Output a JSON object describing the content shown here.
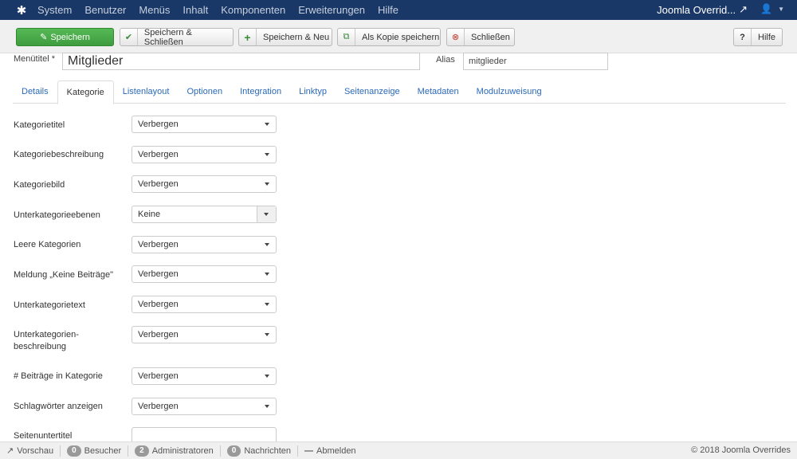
{
  "navbar": {
    "logo_icon": "joomla-icon",
    "menu": [
      "System",
      "Benutzer",
      "Menüs",
      "Inhalt",
      "Komponenten",
      "Erweiterungen",
      "Hilfe"
    ],
    "site_name": "Joomla Overrid...",
    "bg_color": "#1a3867"
  },
  "toolbar": {
    "save": "Speichern",
    "save_close": "Speichern & Schließen",
    "save_new": "Speichern & Neu",
    "save_copy": "Als Kopie speichern",
    "close": "Schließen",
    "help": "Hilfe"
  },
  "title": {
    "label": "Menütitel *",
    "value": "Mitglieder",
    "alias_label": "Alias",
    "alias_value": "mitglieder"
  },
  "tabs": [
    "Details",
    "Kategorie",
    "Listenlayout",
    "Optionen",
    "Integration",
    "Linktyp",
    "Seitenanzeige",
    "Metadaten",
    "Modulzuweisung"
  ],
  "active_tab": "Kategorie",
  "fields": [
    {
      "label": "Kategorietitel",
      "value": "Verbergen"
    },
    {
      "label": "Kategoriebeschreibung",
      "value": "Verbergen"
    },
    {
      "label": "Kategoriebild",
      "value": "Verbergen"
    },
    {
      "label": "Unterkategorieebenen",
      "value": "Keine"
    },
    {
      "label": "Leere Kategorien",
      "value": "Verbergen"
    },
    {
      "label": "Meldung „Keine Beiträge\"",
      "value": "Verbergen"
    },
    {
      "label": "Unterkategorietext",
      "value": "Verbergen"
    },
    {
      "label": "Unterkategorien-beschreibung",
      "value": "Verbergen"
    },
    {
      "label": "# Beiträge in Kategorie",
      "value": "Verbergen"
    },
    {
      "label": "Schlagwörter anzeigen",
      "value": "Verbergen"
    },
    {
      "label": "Seitenuntertitel",
      "value": ""
    }
  ],
  "statusbar": {
    "preview": "Vorschau",
    "visitors_count": "0",
    "visitors": "Besucher",
    "admins_count": "2",
    "admins": "Administratoren",
    "messages_count": "0",
    "messages": "Nachrichten",
    "logout": "Abmelden",
    "copyright": "© 2018 Joomla Overrides"
  }
}
